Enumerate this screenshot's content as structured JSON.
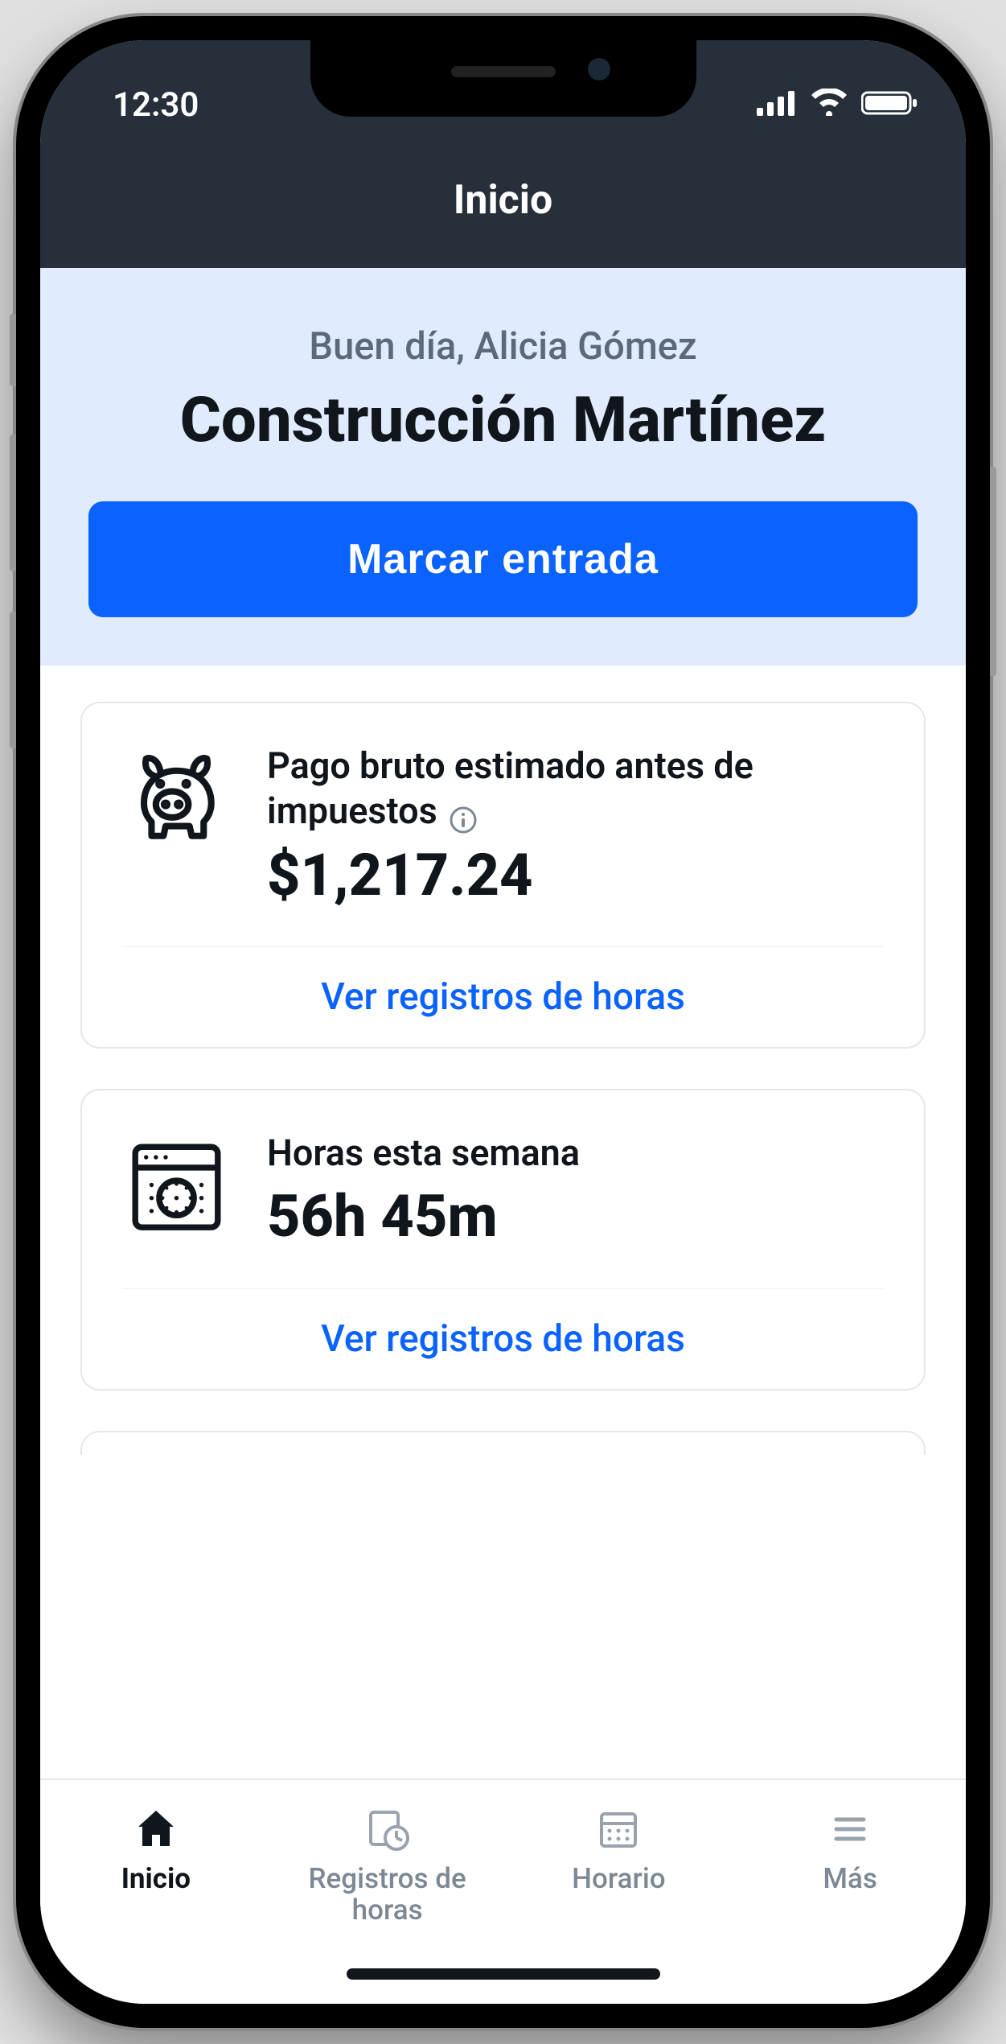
{
  "status": {
    "time": "12:30"
  },
  "header": {
    "title": "Inicio"
  },
  "hero": {
    "greeting": "Buen día, Alicia Gómez",
    "company": "Construcción Martínez",
    "cta": "Marcar entrada"
  },
  "cards": {
    "pay": {
      "label": "Pago bruto estimado antes de impuestos",
      "value": "$1,217.24",
      "link": "Ver registros de horas"
    },
    "hours": {
      "label": "Horas esta semana",
      "value": "56h 45m",
      "link": "Ver registros de horas"
    }
  },
  "tabs": {
    "home": "Inicio",
    "timesheets": "Registros de horas",
    "schedule": "Horario",
    "more": "Más"
  }
}
